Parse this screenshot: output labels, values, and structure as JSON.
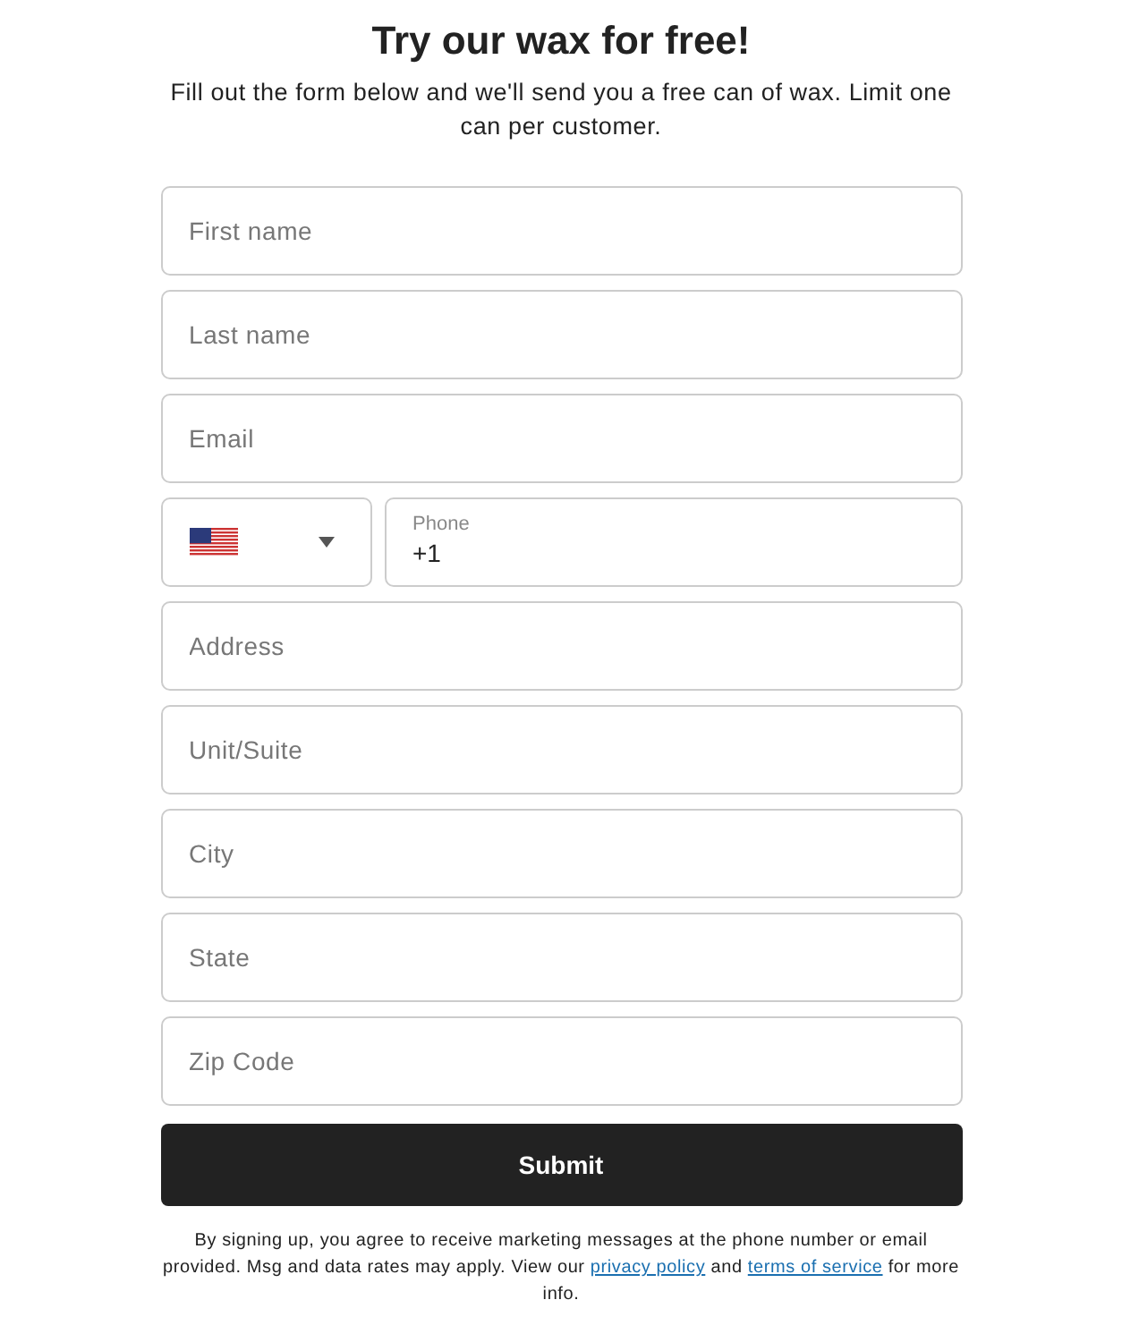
{
  "title": "Try our wax for free!",
  "intro": "Fill out the form below and we'll send you a free can of wax. Limit one can per customer.",
  "fields": [
    {
      "kind": "text",
      "placeholder": "First name"
    },
    {
      "kind": "text",
      "placeholder": "Last name"
    },
    {
      "kind": "text",
      "placeholder": "Email"
    },
    {
      "kind": "phone",
      "label": "Phone",
      "value": "+1"
    },
    {
      "kind": "text",
      "placeholder": "Address"
    },
    {
      "kind": "text",
      "placeholder": "Unit/Suite"
    },
    {
      "kind": "text",
      "placeholder": "City"
    },
    {
      "kind": "text",
      "placeholder": "State"
    },
    {
      "kind": "text",
      "placeholder": "Zip Code"
    }
  ],
  "submit": "Submit",
  "disclaimer": [
    {
      "kind": "text",
      "text": "By signing up, you agree to receive marketing messages at the phone number or email provided. Msg and data rates may apply. View our "
    },
    {
      "kind": "link",
      "text": "privacy policy"
    },
    {
      "kind": "text",
      "text": " and "
    },
    {
      "kind": "link",
      "text": "terms of service"
    },
    {
      "kind": "text",
      "text": " for more info."
    }
  ]
}
